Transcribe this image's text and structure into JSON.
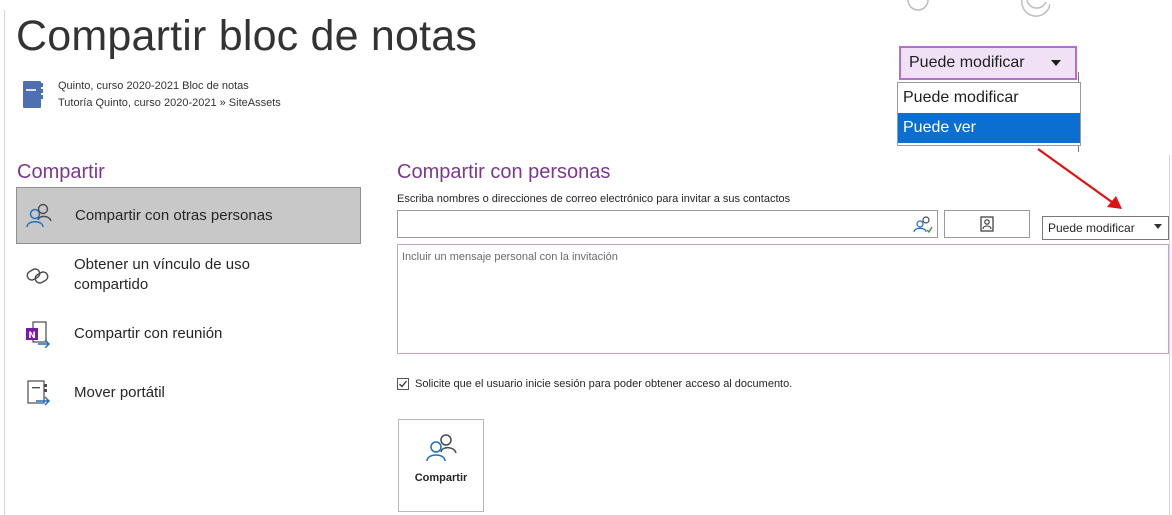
{
  "page_title": "Compartir bloc de notas",
  "notebook": {
    "name": "Quinto, curso 2020-2021 Bloc de notas",
    "location": "Tutoría Quinto, curso 2020-2021 » SiteAssets"
  },
  "left_section_title": "Compartir",
  "nav": {
    "items": [
      {
        "label": "Compartir con otras personas",
        "icon": "people-icon",
        "active": true
      },
      {
        "label": "Obtener un vínculo de uso compartido",
        "icon": "link-icon",
        "active": false
      },
      {
        "label": "Compartir con reunión",
        "icon": "onenote-meeting-icon",
        "active": false
      },
      {
        "label": "Mover portátil",
        "icon": "move-notebook-icon",
        "active": false
      }
    ]
  },
  "share_panel": {
    "title": "Compartir con personas",
    "invite_label": "Escriba nombres o direcciones de correo electrónico para invitar a sus contactos",
    "names_value": "",
    "permission_value": "Puede modificar",
    "message_placeholder": "Incluir un mensaje personal con la invitación",
    "signin_label": "Solicite que el usuario inicie sesión para poder obtener acceso al documento.",
    "signin_checked": true,
    "share_button_label": "Compartir"
  },
  "dropdown_inset": {
    "selected": "Puede modificar",
    "options": [
      "Puede modificar",
      "Puede ver"
    ],
    "highlighted": "Puede ver"
  },
  "colors": {
    "accent_purple": "#7a3a8c",
    "highlight_blue": "#0b6fd1",
    "annotation_red": "#e01010",
    "active_nav_bg": "#c8c8c8"
  }
}
